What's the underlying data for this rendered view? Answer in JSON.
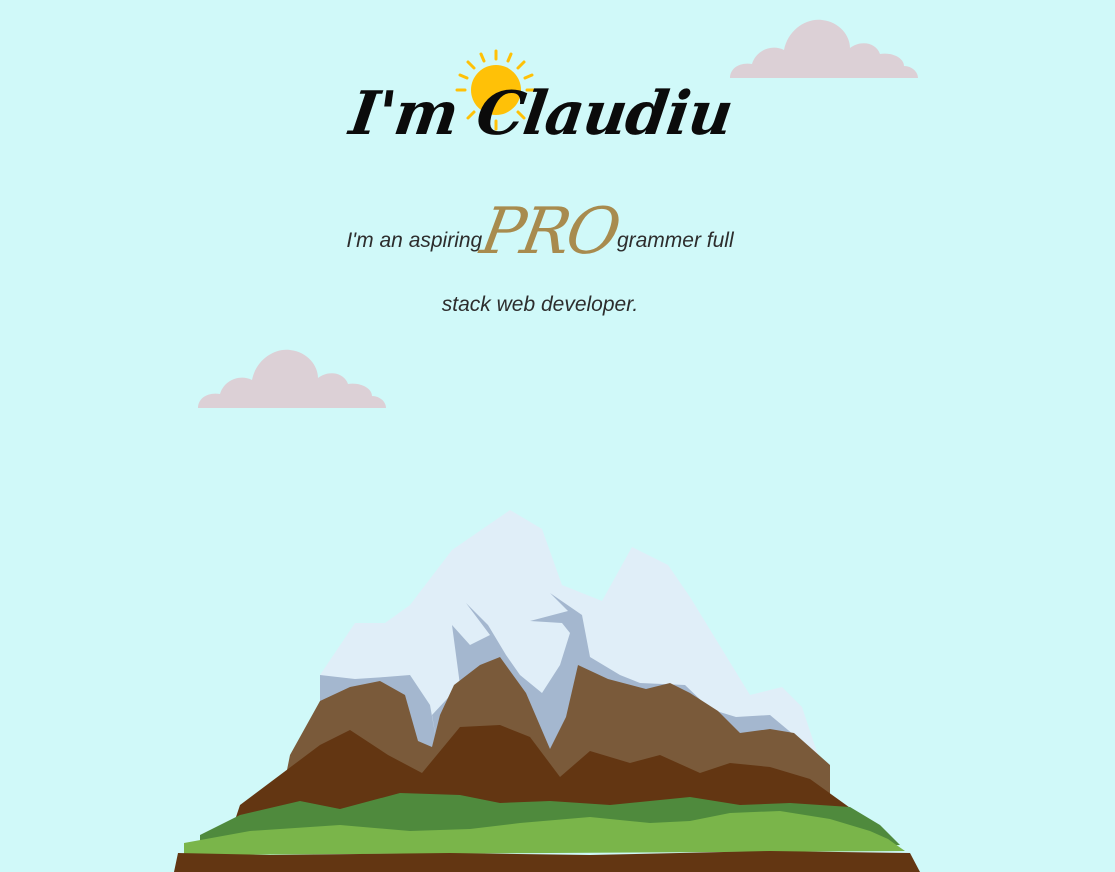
{
  "header": {
    "title": "I'm Claudiu"
  },
  "intro": {
    "text_before": "I'm an aspiring",
    "highlight": "PRO",
    "text_after_line1": "grammer full",
    "text_line2": "stack web developer."
  },
  "colors": {
    "sky": "#d0f9f9",
    "cloud": "#dcd0d6",
    "sun": "#ffc107",
    "highlight": "#a88b4e",
    "snow": "#e0eef8",
    "rock_light": "#a4b7cf",
    "rock_mid": "#7a5a3a",
    "rock_dark": "#633612",
    "grass_dark": "#4f8a3d",
    "grass_light": "#7ab54a"
  },
  "icons": {
    "sun": "sun-icon",
    "clouds": [
      "cloud-icon",
      "cloud-icon"
    ],
    "mountain": "mountain-illustration"
  }
}
